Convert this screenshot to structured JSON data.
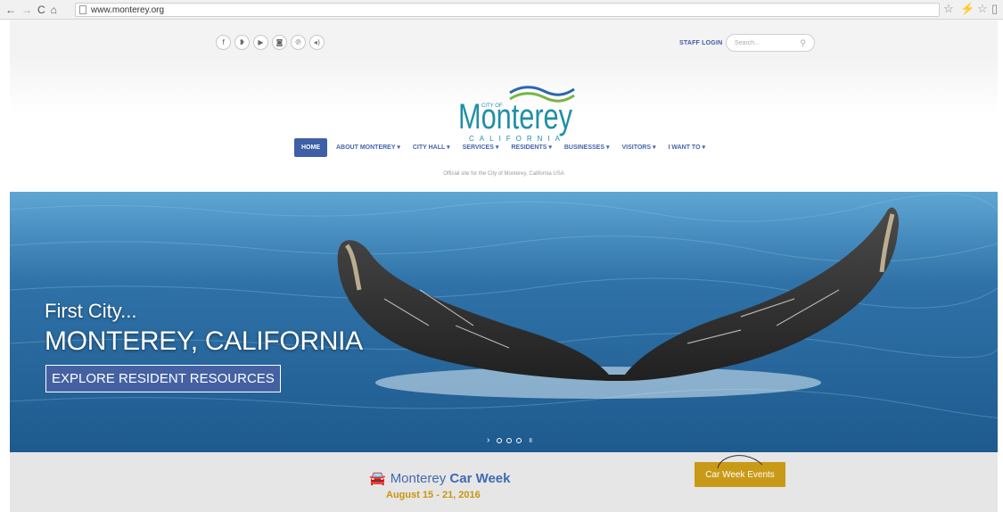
{
  "browser": {
    "url": "www.monterey.org",
    "back_icon": "back-arrow-icon",
    "forward_icon": "forward-arrow-icon",
    "reload_icon": "reload-icon",
    "home_icon": "home-icon",
    "bookmark_icon": "star-icon"
  },
  "header": {
    "social_icons": [
      {
        "name": "facebook-icon",
        "glyph": "f"
      },
      {
        "name": "twitter-icon",
        "glyph": "❥"
      },
      {
        "name": "youtube-icon",
        "glyph": "▶"
      },
      {
        "name": "instagram-icon",
        "glyph": "◙"
      },
      {
        "name": "pinterest-icon",
        "glyph": "℗"
      },
      {
        "name": "rss-icon",
        "glyph": "◂)"
      }
    ],
    "staff_login": "STAFF LOGIN",
    "search_placeholder": "Search...",
    "logo": {
      "city_of": "CITY OF",
      "name": "Monterey",
      "state": "CALIFORNIA"
    },
    "nav": [
      {
        "label": "HOME"
      },
      {
        "label": "ABOUT MONTEREY ▾"
      },
      {
        "label": "CITY HALL ▾"
      },
      {
        "label": "SERVICES ▾"
      },
      {
        "label": "RESIDENTS ▾"
      },
      {
        "label": "BUSINESSES ▾"
      },
      {
        "label": "VISITORS ▾"
      },
      {
        "label": "I WANT TO ▾"
      }
    ],
    "tagline": "Official site for the City of Monterey, California USA"
  },
  "hero": {
    "subtitle": "First City...",
    "title": "MONTEREY, CALIFORNIA",
    "button": "EXPLORE RESIDENT RESOURCES"
  },
  "carweek": {
    "title_prefix": "Monterey",
    "title_bold": "Car Week",
    "dates": "August 15 - 21, 2016",
    "button": "Car Week Events"
  },
  "colors": {
    "nav_blue": "#3f5fa6",
    "gold": "#c99a18",
    "ocean": "#2f72a8"
  }
}
